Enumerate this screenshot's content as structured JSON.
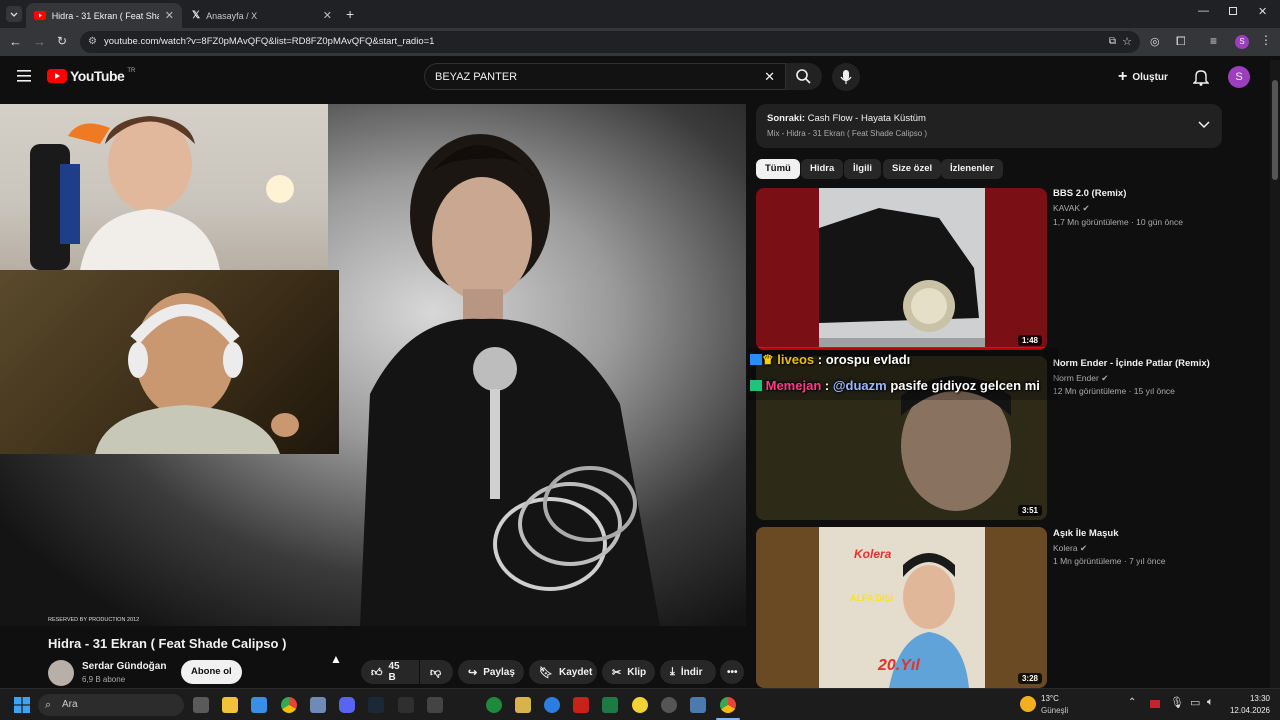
{
  "browser": {
    "tabs": [
      {
        "label": "Hidra - 31 Ekran ( Feat Shade C",
        "active": true,
        "icon": "youtube-favicon"
      },
      {
        "label": "Anasayfa / X",
        "active": false,
        "icon": "x-favicon"
      }
    ],
    "url": "youtube.com/watch?v=8FZ0pMAvQFQ&list=RD8FZ0pMAvQFQ&start_radio=1",
    "profile_initial": "S"
  },
  "youtube": {
    "logo_text": "YouTube",
    "logo_region": "TR",
    "search_value": "BEYAZ PANTER",
    "create_label": "Oluştur",
    "avatar_initial": "S",
    "brand_color": "#ff0000"
  },
  "video": {
    "watermark": "RESERVED BY PRODUCTION 2012",
    "title": "Hidra - 31 Ekran ( Feat Shade Calipso )",
    "channel_name": "Serdar Gündoğan",
    "subscribers": "6,9 B abone",
    "subscribe_label": "Abone ol",
    "like_count": "45 B",
    "share_label": "Paylaş",
    "save_label": "Kaydet",
    "clip_label": "Klip",
    "download_label": "İndir"
  },
  "playlist": {
    "next_prefix": "Sonraki:",
    "next_title": "Cash Flow - Hayata Küstüm",
    "mix_title": "Mix - Hidra - 31 Ekran ( Feat Shade Calipso )"
  },
  "chips": [
    "Tümü",
    "Hidra",
    "İlgili",
    "Size özel",
    "İzlenenler"
  ],
  "recommendations": [
    {
      "title": "BBS 2.0 (Remix)",
      "channel": "KAVAK",
      "meta": "1,7 Mn görüntüleme · 10 gün önce",
      "duration": "1:48"
    },
    {
      "title": "Norm Ender - İçinde Patlar (Remix)",
      "channel": "Norm Ender",
      "meta": "12 Mn görüntüleme · 15 yıl önce",
      "duration": "3:51"
    },
    {
      "title": "Aşık İle Maşuk",
      "channel": "Kolera",
      "meta": "1 Mn görüntüleme · 7 yıl önce",
      "duration": "3:28",
      "thumb_text_top": "Kolera",
      "thumb_text_mid": "ALFA DİŞİ",
      "thumb_text_bottom": "20.Yıl"
    }
  ],
  "chat_overlay": [
    {
      "user": "liveos",
      "separator": ":",
      "message": "orospu evladı",
      "user_color": "#e8c200"
    },
    {
      "user": "Memejan",
      "separator": ":",
      "mention": "@duazm",
      "message": "pasife gidiyoz gelcen mi",
      "user_color": "#ff3b8d",
      "mention_color": "#9ab8ff"
    }
  ],
  "taskbar": {
    "search_placeholder": "Ara",
    "weather_temp": "13°C",
    "weather_desc": "Güneşli",
    "time": "13:30",
    "date": "12.04.2026"
  }
}
